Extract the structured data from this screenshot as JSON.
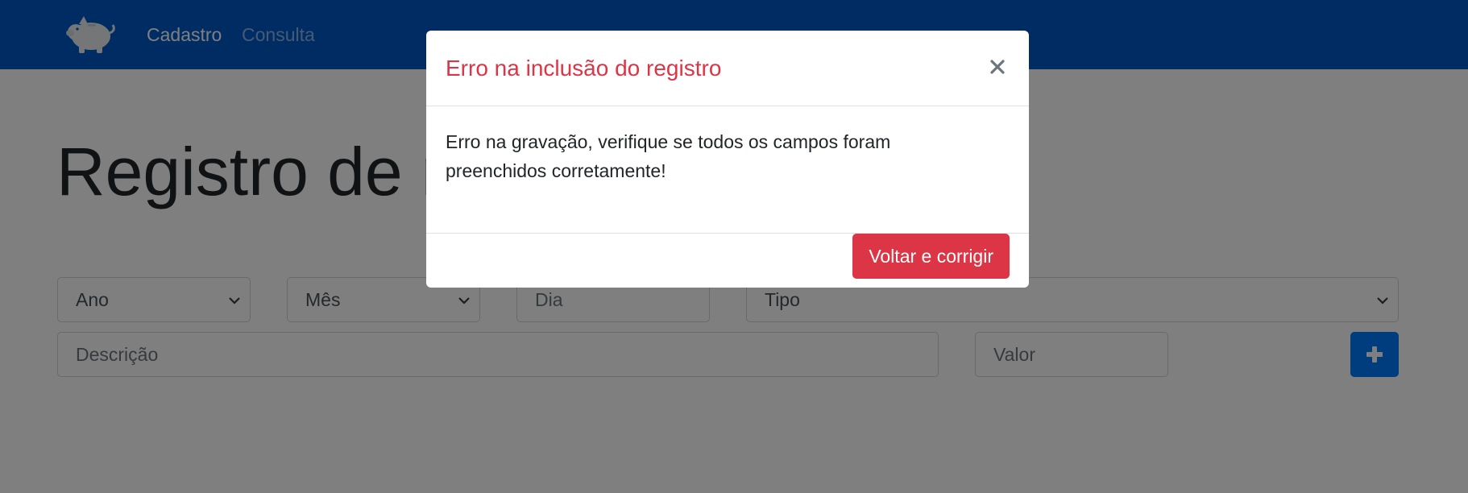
{
  "navbar": {
    "logo_icon": "piggy-bank-icon",
    "links": [
      {
        "label": "Cadastro",
        "active": true
      },
      {
        "label": "Consulta",
        "active": false
      }
    ],
    "background": "#0059c9"
  },
  "main": {
    "title": "Registro de n",
    "form": {
      "ano": {
        "selected": "Ano"
      },
      "mes": {
        "selected": "Mês"
      },
      "dia": {
        "placeholder": "Dia"
      },
      "tipo": {
        "selected": "Tipo"
      },
      "descricao": {
        "placeholder": "Descrição"
      },
      "valor": {
        "placeholder": "Valor"
      },
      "add_icon": "plus-icon"
    }
  },
  "modal": {
    "title": "Erro na inclusão do registro",
    "close_icon": "close-icon",
    "body": "Erro na gravação, verifique se todos os campos foram preenchidos corretamente!",
    "button_label": "Voltar e corrigir",
    "title_color": "#dc3545",
    "button_color": "#dc3545"
  }
}
